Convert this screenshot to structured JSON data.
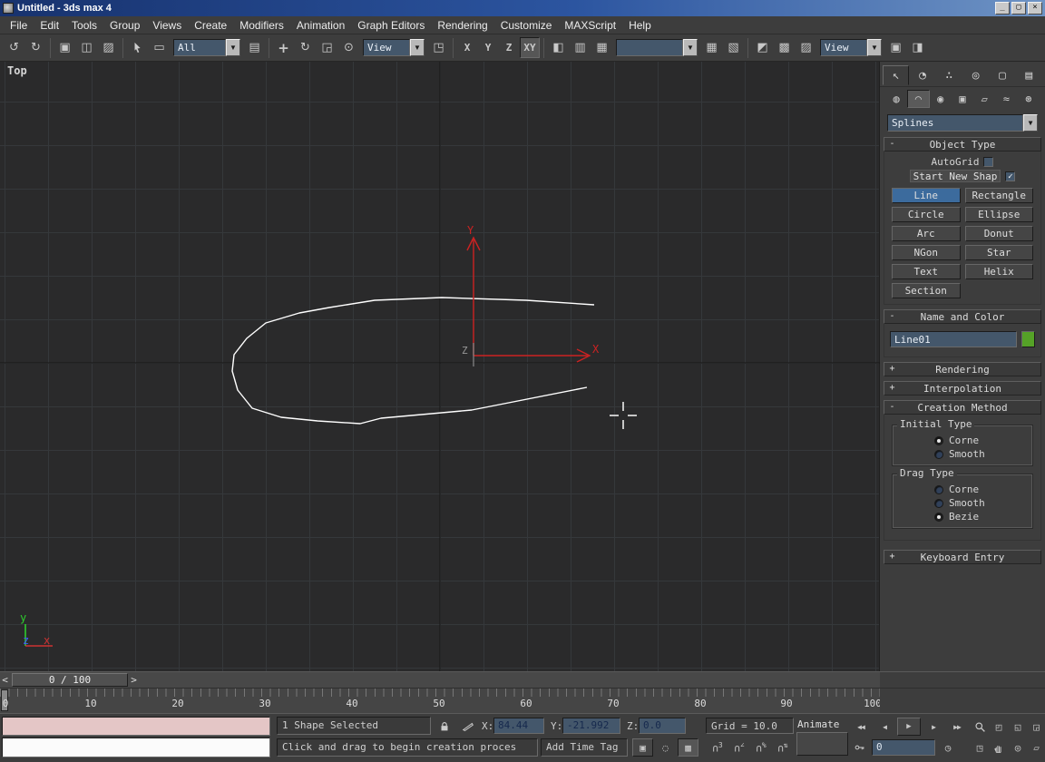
{
  "window": {
    "title": "Untitled - 3ds max 4"
  },
  "menu": {
    "items": [
      "File",
      "Edit",
      "Tools",
      "Group",
      "Views",
      "Create",
      "Modifiers",
      "Animation",
      "Graph Editors",
      "Rendering",
      "Customize",
      "MAXScript",
      "Help"
    ]
  },
  "toolbar": {
    "selection_filter": "All",
    "coord_system": "View",
    "render_type": "View",
    "constraint_x": "X",
    "constraint_y": "Y",
    "constraint_z": "Z",
    "constraint_xy": "XY"
  },
  "viewport": {
    "label": "Top",
    "spline": "655,268 580,263 487,260 413,263 363,271 330,277 293,288 272,305 258,323 256,341 262,362 278,382 310,392 350,396 397,399 420,393 520,384 647,359",
    "tripod": {
      "x": "X",
      "y": "Y",
      "z": "Z"
    },
    "world": {
      "x": "x",
      "y": "y",
      "z": "z"
    }
  },
  "command_panel": {
    "subcategory": "Splines",
    "object_type": {
      "title": "Object Type",
      "state": "-",
      "autogrid": "AutoGrid",
      "start_new_shape": "Start New Shap",
      "buttons": [
        "Line",
        "Rectangle",
        "Circle",
        "Ellipse",
        "Arc",
        "Donut",
        "NGon",
        "Star",
        "Text",
        "Helix",
        "Section"
      ],
      "active": "Line"
    },
    "name_color": {
      "title": "Name and Color",
      "state": "-",
      "name": "Line01",
      "swatch_style": "background:#55a227"
    },
    "rendering": {
      "title": "Rendering",
      "state": "+"
    },
    "interpolation": {
      "title": "Interpolation",
      "state": "+"
    },
    "creation_method": {
      "title": "Creation Method",
      "state": "-",
      "initial_type": {
        "label": "Initial Type",
        "opt1": "Corne",
        "opt2": "Smooth",
        "selected": "Corne"
      },
      "drag_type": {
        "label": "Drag Type",
        "opt1": "Corne",
        "opt2": "Smooth",
        "opt3": "Bezie",
        "selected": "Bezie"
      }
    },
    "keyboard_entry": {
      "title": "Keyboard Entry",
      "state": "+"
    }
  },
  "timeline": {
    "slider": "0 / 100",
    "ticks": [
      "0",
      "10",
      "20",
      "30",
      "40",
      "50",
      "60",
      "70",
      "80",
      "90",
      "100"
    ]
  },
  "status": {
    "selection": "1 Shape Selected",
    "x_label": "X:",
    "x": "84.44",
    "y_label": "Y:",
    "y": "-21.992",
    "z_label": "Z:",
    "z": "0.0",
    "grid": "Grid = 10.0",
    "prompt": "Click and drag to begin creation proces",
    "add_time_tag": "Add Time Tag",
    "animate": "Animate",
    "frame": "0"
  },
  "colors": {
    "viewport_bg": "#2a2a2b",
    "panel_bg": "#3d3d3d",
    "selected_button": "#3c6b9d",
    "object_color": "#55a227",
    "field_bg": "#44576b",
    "titlebar_blue": "#17326e",
    "spline": "#ffffff",
    "tripod_red": "#cc2222"
  },
  "icons": {
    "dropdown": "▼",
    "undo": "↺",
    "redo": "↻",
    "link": "▣",
    "unlink": "◫",
    "bind": "▨",
    "region": "▭",
    "byname": "▤",
    "move": "+",
    "rotate": "↻",
    "scale": "◲",
    "center": "⊙",
    "manip": "◳",
    "mirror": "◧",
    "align": "▥",
    "array": "▦",
    "track": "▦",
    "schem": "▧",
    "mtl": "◩",
    "rscene": "▩",
    "rlast": "▨",
    "rbtn1": "▣",
    "rbtn2": "◨",
    "tab_create": "↖",
    "tab_modify": "◔",
    "tab_hier": "∴",
    "tab_motion": "◎",
    "tab_disp": "▢",
    "tab_util": "▤",
    "cat_geo": "◍",
    "cat_shapes": "◠",
    "cat_lights": "◉",
    "cat_cam": "▣",
    "cat_help": "▱",
    "cat_warp": "≈",
    "cat_sys": "⊛",
    "snap": "∩",
    "snap3": "3",
    "snapA": "∠",
    "snapP": "%",
    "snapS": "⇅",
    "tgl1": "▣",
    "tgl2": "◌",
    "tgl3": "▩",
    "pstart": "◀◀",
    "pprev": "◀",
    "play": "▶",
    "pnext": "▶",
    "pend": "▶▶",
    "clock": "◷",
    "nzoomall": "◰",
    "nextents": "◱",
    "nextentsall": "◲",
    "nregion": "◳",
    "nrot": "◎",
    "nmax": "▱",
    "min": "_",
    "max": "▢",
    "close": "×",
    "sl": "<",
    "sr": ">",
    "check": "✓"
  }
}
